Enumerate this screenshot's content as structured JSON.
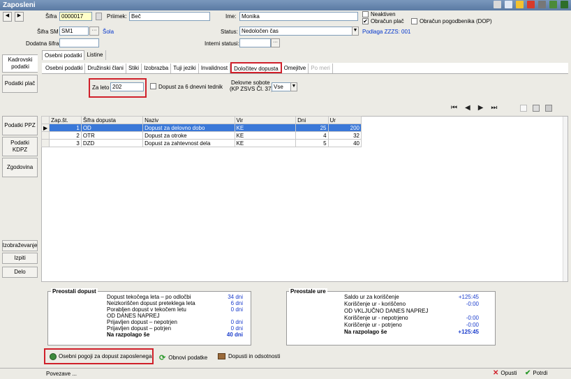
{
  "window": {
    "title": "Zaposleni"
  },
  "header": {
    "sifra_label": "Šifra",
    "sifra_value": "0000017",
    "priimek_label": "Priimek:",
    "priimek_value": "Beč",
    "ime_label": "Ime:",
    "ime_value": "Monika",
    "sifra_sm_label": "Šifra SM",
    "sifra_sm_value": "SM1",
    "sifra_sm_link": "Šola",
    "status_label": "Status:",
    "status_value": "Nedoločen čas",
    "dodatna_label": "Dodatna šifra:",
    "interni_label": "Interni statusi:",
    "neaktiven_label": "Neaktiven",
    "obracun_plac_label": "Obračun plač",
    "obracun_pogodbenika_label": "Obračun pogodbenika (DOP)",
    "podlaga_link": "Podlaga ZZZS: 001"
  },
  "sidebar": {
    "items": [
      {
        "label": "Kadrovski podatki"
      },
      {
        "label": "Podatki plač"
      },
      {
        "label": "Podatki PPZ"
      },
      {
        "label": "Podatki KDPZ"
      },
      {
        "label": "Zgodovina"
      },
      {
        "label": "Izobraževanje"
      },
      {
        "label": "Izpiti"
      },
      {
        "label": "Delo"
      }
    ]
  },
  "tabs_top": [
    {
      "label": "Osebni podatki"
    },
    {
      "label": "Listine"
    }
  ],
  "tabs_sub": [
    {
      "label": "Osebni podatki"
    },
    {
      "label": "Družinski člani"
    },
    {
      "label": "Stiki"
    },
    {
      "label": "Izobrazba"
    },
    {
      "label": "Tuji jeziki"
    },
    {
      "label": "Invalidnost"
    },
    {
      "label": "Določitev dopusta"
    },
    {
      "label": "Omejitve"
    },
    {
      "label": "Po meri"
    }
  ],
  "filter": {
    "za_leto_label": "Za leto",
    "za_leto_value": "202",
    "dopust6_label": "Dopust za 6 dnevni tednik",
    "delovne_label1": "Delovne sobote",
    "delovne_label2": "(KP ZSVS Čl. 37)",
    "delovne_value": "Vse"
  },
  "table": {
    "headers": [
      "Zap.št.",
      "Šifra dopusta",
      "Naziv",
      "Vir",
      "Dni",
      "Ur"
    ],
    "rows": [
      {
        "zap": "1",
        "sifra": "OD",
        "naziv": "Dopust za delovno dobo",
        "vir": "KE",
        "dni": "25",
        "ur": "200"
      },
      {
        "zap": "2",
        "sifra": "OTR",
        "naziv": "Dopust za otroke",
        "vir": "KE",
        "dni": "4",
        "ur": "32"
      },
      {
        "zap": "3",
        "sifra": "DZD",
        "naziv": "Dopust za zahtevnost dela",
        "vir": "KE",
        "dni": "5",
        "ur": "40"
      }
    ]
  },
  "preostali_dopust": {
    "title": "Preostali dopust",
    "rows": [
      {
        "label": "Dopust tekočega leta – po odločbi",
        "value": "34 dni"
      },
      {
        "label": "Neizkoriščen dopust preteklega leta",
        "value": "6 dni"
      },
      {
        "label": "Porabljen dopust v tekočem letu",
        "value": "0 dni"
      },
      {
        "label": "OD DANES NAPREJ",
        "value": ""
      },
      {
        "label": "Prijavljen dopust – nepotrjen",
        "value": "0 dni"
      },
      {
        "label": "Prijavljen dopust – potrjen",
        "value": "0 dni"
      }
    ],
    "total_label": "Na razpolago še",
    "total_value": "40 dni"
  },
  "preostale_ure": {
    "title": "Preostale ure",
    "rows": [
      {
        "label": "Saldo ur za koriščenje",
        "value": "+125:45"
      },
      {
        "label": "Koriščenje ur - koriščeno",
        "value": "-0:00"
      },
      {
        "label": "OD VKLJUČNO DANES NAPREJ",
        "value": ""
      },
      {
        "label": "Koriščenje ur - nepotrjeno",
        "value": "-0:00"
      },
      {
        "label": "Koriščenje ur - potrjeno",
        "value": "-0:00"
      }
    ],
    "total_label": "Na razpolago še",
    "total_value": "+125:45"
  },
  "bottom_buttons": {
    "osebni_pogoji": "Osebni pogoji za dopust zaposlenega",
    "obnovi": "Obnovi podatke",
    "dopusti": "Dopusti in odsotnosti"
  },
  "status": {
    "povezave": "Povezave ...",
    "opusti": "Opusti",
    "potrdi": "Potrdi"
  },
  "colors": {
    "selection": "#3a78d8",
    "highlight": "#d0202a",
    "link": "#0033cc"
  }
}
